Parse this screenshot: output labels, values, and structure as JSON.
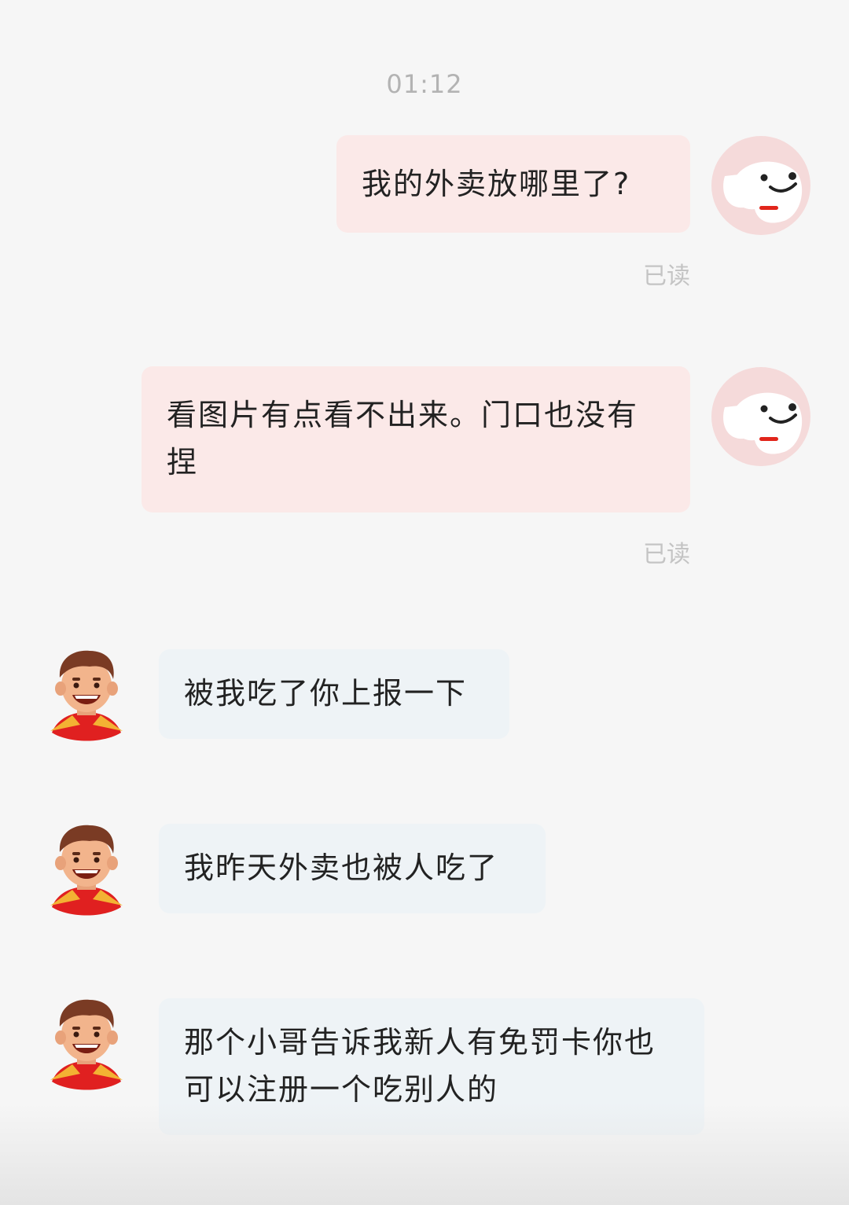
{
  "chat": {
    "timestamp": "01:12",
    "messages": [
      {
        "sender": "me",
        "text": "我的外卖放哪里了?",
        "status": "已读",
        "avatar_icon": "joy-dog-avatar-icon"
      },
      {
        "sender": "me",
        "text": "看图片有点看不出来。门口也没有捏",
        "status": "已读",
        "avatar_icon": "joy-dog-avatar-icon"
      },
      {
        "sender": "courier",
        "text": "被我吃了你上报一下",
        "avatar_icon": "courier-avatar-icon"
      },
      {
        "sender": "courier",
        "text": "我昨天外卖也被人吃了",
        "avatar_icon": "courier-avatar-icon"
      },
      {
        "sender": "courier",
        "text": "那个小哥告诉我新人有免罚卡你也可以注册一个吃别人的",
        "avatar_icon": "courier-avatar-icon"
      }
    ]
  },
  "colors": {
    "my_bubble": "#fbe9e8",
    "other_bubble": "#eef3f6",
    "accent_red": "#e1251b"
  }
}
